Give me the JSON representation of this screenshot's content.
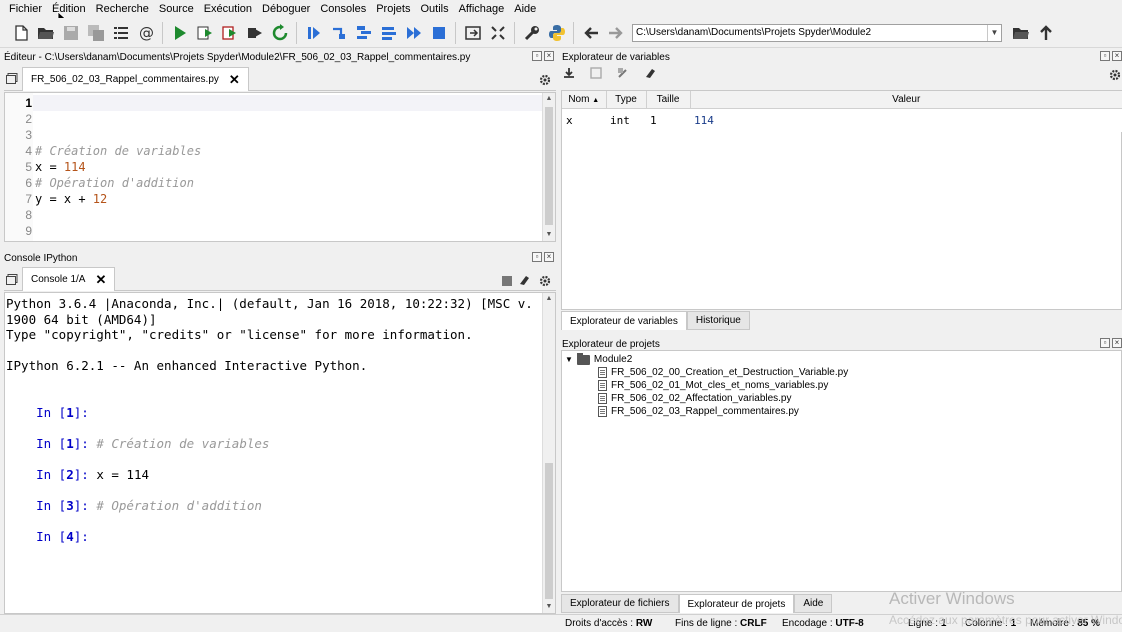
{
  "menu": [
    "Fichier",
    "Édition",
    "Recherche",
    "Source",
    "Exécution",
    "Déboguer",
    "Consoles",
    "Projets",
    "Outils",
    "Affichage",
    "Aide"
  ],
  "toolbar": {
    "path": "C:\\Users\\danam\\Documents\\Projets Spyder\\Module2"
  },
  "editor": {
    "pane_title": "Éditeur - C:\\Users\\danam\\Documents\\Projets Spyder\\Module2\\FR_506_02_03_Rappel_commentaires.py",
    "tab_label": "FR_506_02_03_Rappel_commentaires.py",
    "line_numbers": [
      "1",
      "2",
      "3",
      "4",
      "5",
      "6",
      "7",
      "8",
      "9"
    ],
    "comment1": "# Création de variables",
    "line5_prefix": "x = ",
    "line5_num": "114",
    "comment2": "# Opération d'addition",
    "line7_prefix": "y = x + ",
    "line7_num": "12"
  },
  "console": {
    "pane_title": "Console IPython",
    "tab_label": "Console 1/A",
    "lines": [
      "Python 3.6.4 |Anaconda, Inc.| (default, Jan 16 2018, 10:22:32) [MSC v.",
      "1900 64 bit (AMD64)]",
      "Type \"copyright\", \"credits\" or \"license\" for more information.",
      "IPython 6.2.1 -- An enhanced Interactive Python."
    ],
    "prompts": [
      {
        "prefix": "In [",
        "n": "1",
        "suffix": "]: ",
        "text": "",
        "comment": false
      },
      {
        "prefix": "In [",
        "n": "1",
        "suffix": "]: ",
        "text": "# Création de variables",
        "comment": true
      },
      {
        "prefix": "In [",
        "n": "2",
        "suffix": "]: ",
        "text": "x = 114",
        "comment": false
      },
      {
        "prefix": "In [",
        "n": "3",
        "suffix": "]: ",
        "text": "# Opération d'addition",
        "comment": true
      },
      {
        "prefix": "In [",
        "n": "4",
        "suffix": "]: ",
        "text": "",
        "comment": false
      }
    ]
  },
  "varexp": {
    "pane_title": "Explorateur de variables",
    "headers": [
      "Nom",
      "Type",
      "Taille",
      "Valeur"
    ],
    "rows": [
      {
        "name": "x",
        "type": "int",
        "size": "1",
        "value": "114"
      }
    ],
    "tabs": [
      "Explorateur de variables",
      "Historique"
    ]
  },
  "projexp": {
    "pane_title": "Explorateur de projets",
    "folder": "Module2",
    "files": [
      "FR_506_02_00_Creation_et_Destruction_Variable.py",
      "FR_506_02_01_Mot_cles_et_noms_variables.py",
      "FR_506_02_02_Affectation_variables.py",
      "FR_506_02_03_Rappel_commentaires.py"
    ],
    "tabs": [
      "Explorateur de fichiers",
      "Explorateur de projets",
      "Aide"
    ]
  },
  "status": {
    "rights_label": "Droits d'accès :",
    "rights": "RW",
    "eol_label": "Fins de ligne :",
    "eol": "CRLF",
    "enc_label": "Encodage :",
    "enc": "UTF-8",
    "line_label": "Ligne :",
    "line": "1",
    "col_label": "Colonne :",
    "col": "1",
    "mem_label": "Mémoire :",
    "mem": "85 %"
  },
  "watermark": {
    "title": "Activer Windows",
    "subtitle": "Accédez aux paramètres pour activer Windows."
  }
}
